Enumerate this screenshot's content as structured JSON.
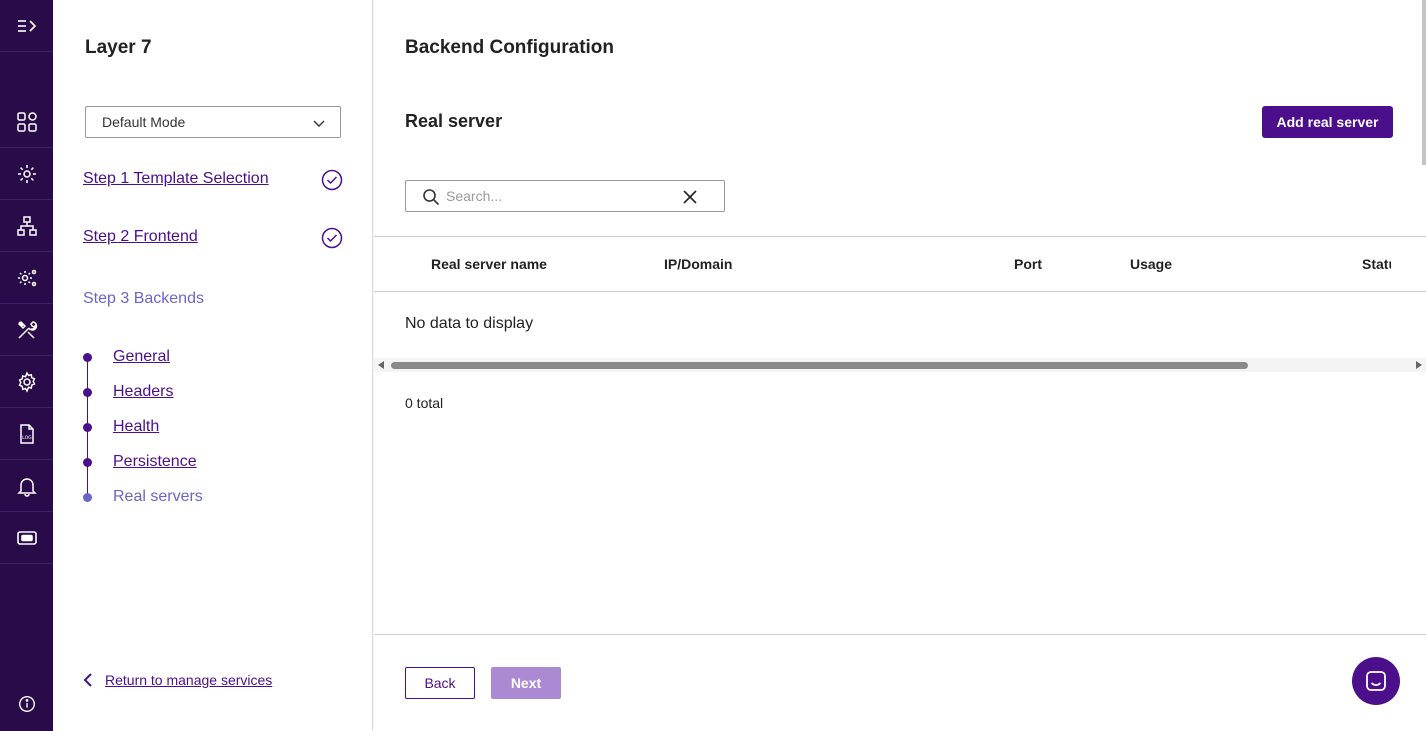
{
  "rail": {
    "items": [
      {
        "name": "expand-menu-icon"
      },
      {
        "name": "dashboard-icon"
      },
      {
        "name": "services-gear-icon"
      },
      {
        "name": "network-topology-icon"
      },
      {
        "name": "cluster-settings-icon"
      },
      {
        "name": "tools-icon"
      },
      {
        "name": "settings-gear-icon"
      },
      {
        "name": "log-file-icon"
      },
      {
        "name": "bell-icon"
      },
      {
        "name": "ticket-icon"
      }
    ],
    "bottom_icon": "info-icon"
  },
  "steps": {
    "title": "Layer 7",
    "mode": "Default Mode",
    "step1": "Step 1 Template Selection",
    "step2": "Step 2 Frontend",
    "step3": "Step 3 Backends",
    "substeps": {
      "general": "General",
      "headers": "Headers",
      "health": "Health",
      "persistence": "Persistence",
      "real_servers": "Real servers"
    },
    "return": "Return to manage services"
  },
  "main": {
    "title": "Backend Configuration",
    "section": "Real server",
    "add_button": "Add real server",
    "search_placeholder": "Search...",
    "columns": {
      "name": "Real server name",
      "ip": "IP/Domain",
      "port": "Port",
      "usage": "Usage",
      "status": "Status"
    },
    "empty": "No data to display",
    "total": "0 total",
    "back": "Back",
    "next": "Next"
  },
  "colors": {
    "brand": "#4b0f8c",
    "rail_bg": "#2a0b4a",
    "current_step": "#6b65c9",
    "disabled_button": "#ab8ad3"
  }
}
